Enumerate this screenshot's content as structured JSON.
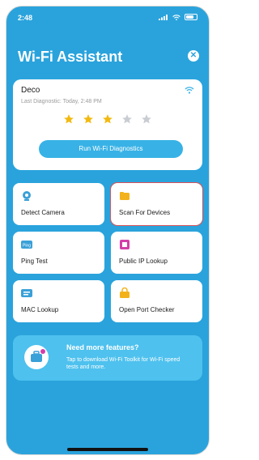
{
  "status": {
    "time": "2:48"
  },
  "header": {
    "title": "Wi-Fi Assistant"
  },
  "device_card": {
    "name": "Deco",
    "last_diagnostic": "Last Diagnostic: Today, 2:48 PM",
    "rating_stars": 3,
    "rating_max": 5,
    "run_button_label": "Run Wi-Fi Diagnostics"
  },
  "tools": [
    {
      "label": "Detect Camera",
      "icon": "camera-icon",
      "icon_color": "#3aa0d8"
    },
    {
      "label": "Scan For Devices",
      "icon": "folder-icon",
      "icon_color": "#f3b21b"
    },
    {
      "label": "Ping Test",
      "icon": "ping-icon",
      "icon_color": "#3aa0d8"
    },
    {
      "label": "Public IP Lookup",
      "icon": "ip-icon",
      "icon_color": "#d43ea9"
    },
    {
      "label": "MAC Lookup",
      "icon": "mac-icon",
      "icon_color": "#3aa0d8"
    },
    {
      "label": "Open Port Checker",
      "icon": "port-icon",
      "icon_color": "#f3b21b"
    }
  ],
  "promo": {
    "title": "Need more features?",
    "text": "Tap to download Wi-Fi Toolkit for Wi-Fi speed tests and more."
  },
  "colors": {
    "header_bg": "#2aa3dc",
    "button": "#38b2e6",
    "star": "#f2b90f",
    "star_empty": "#c9cdd2",
    "highlight": "#d9535a"
  }
}
